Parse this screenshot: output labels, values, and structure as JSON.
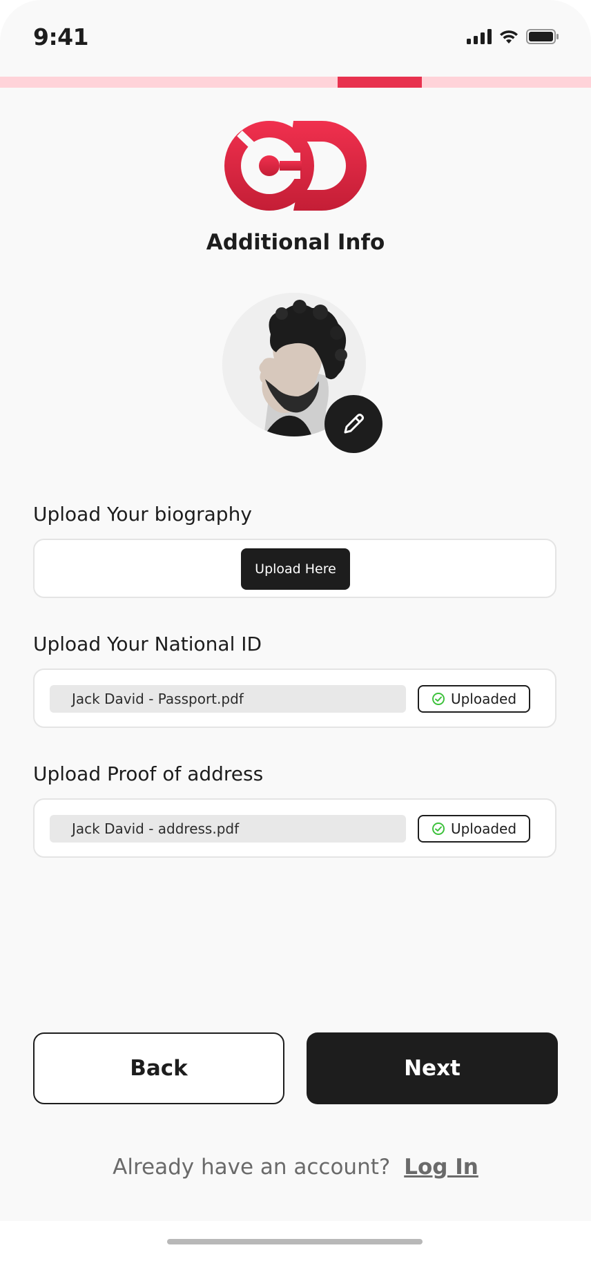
{
  "status_bar": {
    "time": "9:41"
  },
  "progress": {
    "fraction": 0.14,
    "active_color": "#e8324f",
    "track_color": "#ffd3d9"
  },
  "brand": {
    "accent": "#e8324f",
    "dark": "#1d1d1d"
  },
  "header": {
    "title": "Additional Info"
  },
  "profile": {
    "avatar_icon": "profile-photo",
    "edit_icon": "pencil-icon"
  },
  "sections": {
    "biography": {
      "label": "Upload Your biography",
      "button_label": "Upload Here"
    },
    "national_id": {
      "label": "Upload Your National ID",
      "file_name": "Jack David - Passport.pdf",
      "status": "Uploaded"
    },
    "proof_of_address": {
      "label": "Upload Proof of address",
      "file_name": "Jack David - address.pdf",
      "status": "Uploaded"
    }
  },
  "actions": {
    "back_label": "Back",
    "next_label": "Next"
  },
  "footer": {
    "prompt": "Already have an account?",
    "link_label": "Log In"
  }
}
